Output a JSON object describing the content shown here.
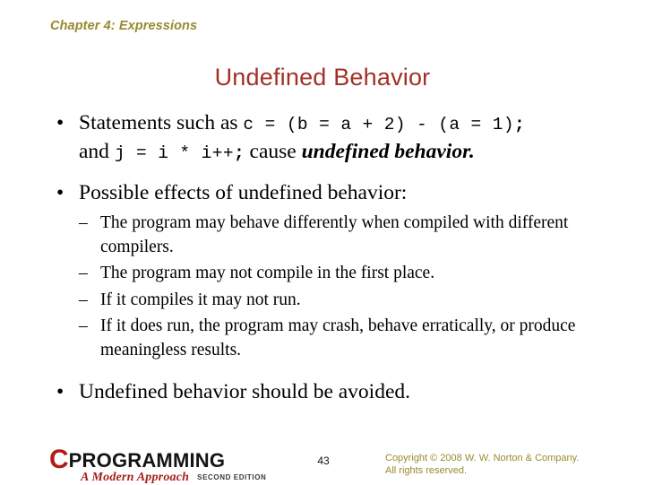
{
  "slide": {
    "chapter_header": "Chapter 4: Expressions",
    "title": "Undefined Behavior",
    "bullet_glyph": "•",
    "dash_glyph": "–"
  },
  "bullets": {
    "b1": {
      "text_1": "Statements such as ",
      "code_1": "c = (b = a + 2) - (a = 1)",
      "code_1_semi": ";",
      "text_2": "and ",
      "code_2": "j = i * i++",
      "code_2_semi": ";",
      "text_3": " cause ",
      "emph": "undefined behavior."
    },
    "b2": {
      "text": "Possible effects of undefined behavior:",
      "sub": [
        "The program may behave differently when compiled with different compilers.",
        "The program may not compile in the first place.",
        "If it compiles it may not run.",
        "If it does run, the program may crash, behave erratically, or produce meaningless results."
      ]
    },
    "b3": {
      "text": "Undefined behavior should be avoided."
    }
  },
  "footer": {
    "logo": {
      "letter_c": "C",
      "word": "PROGRAMMING",
      "subtitle": "A Modern Approach",
      "edition": "SECOND EDITION"
    },
    "page_number": "43",
    "copyright_line1": "Copyright © 2008 W. W. Norton & Company.",
    "copyright_line2": "All rights reserved."
  },
  "colors": {
    "header_olive": "#9a8a2e",
    "title_red": "#a33028",
    "logo_red": "#b31b17",
    "body_black": "#000000",
    "background": "#ffffff"
  }
}
